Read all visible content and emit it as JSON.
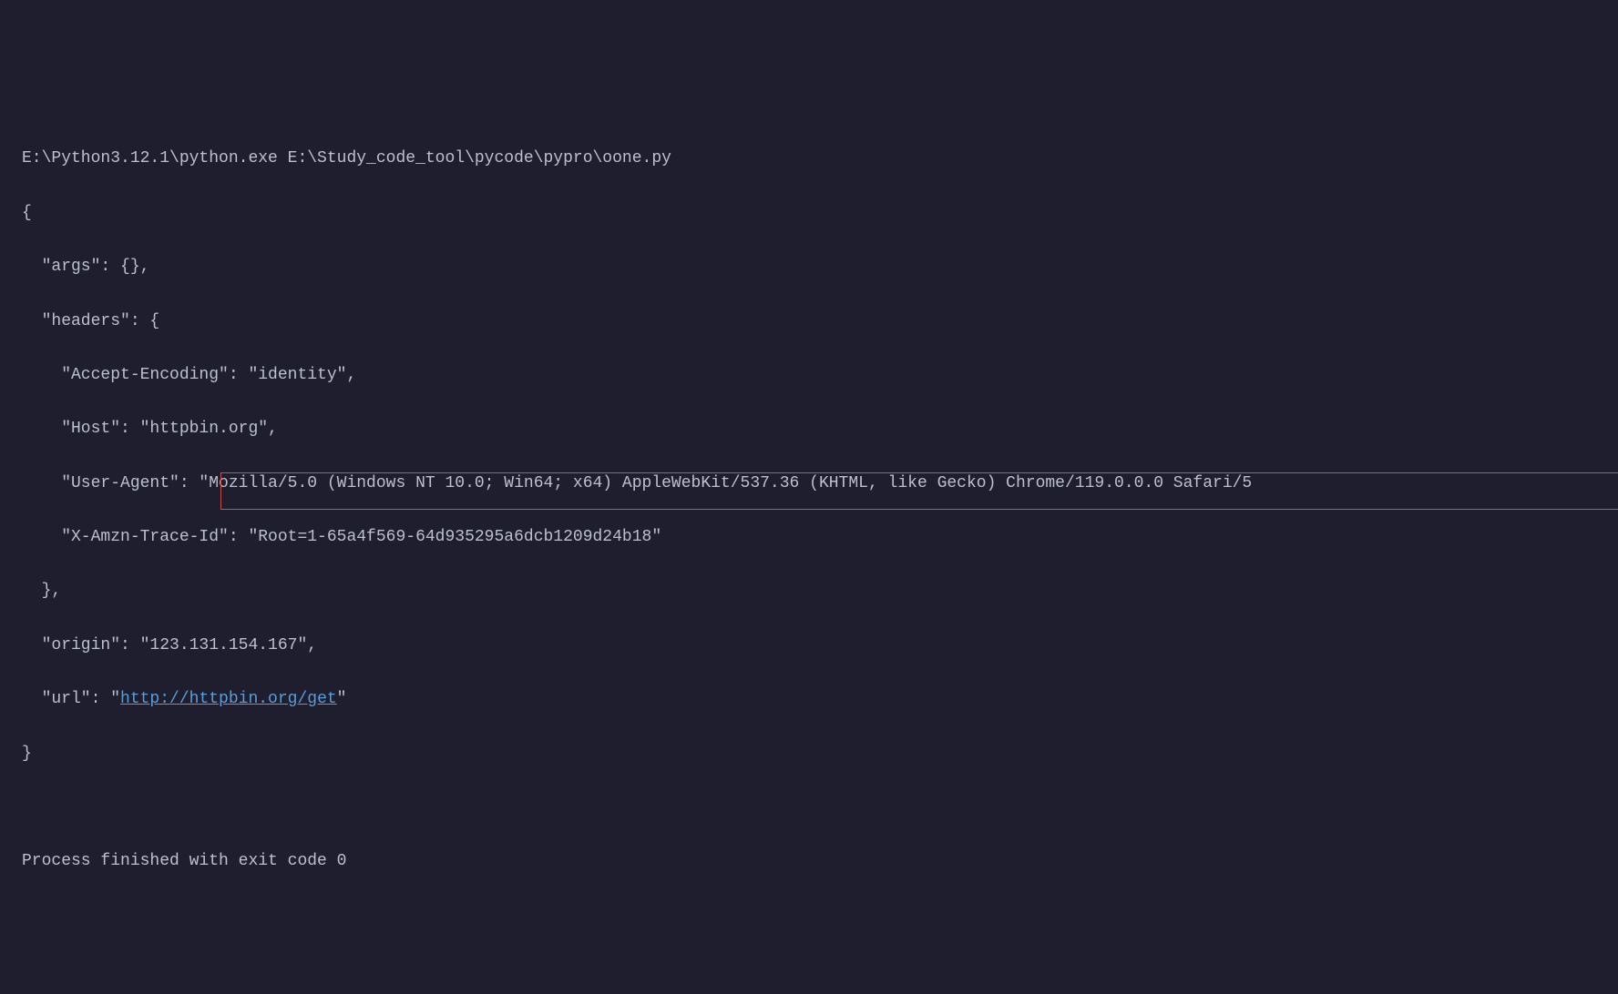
{
  "command_line": "E:\\Python3.12.1\\python.exe E:\\Study_code_tool\\pycode\\pypro\\oone.py",
  "json_open": "{",
  "args_line": "  \"args\": {}, ",
  "headers_open": "  \"headers\": {",
  "accept_encoding": "    \"Accept-Encoding\": \"identity\", ",
  "host_line": "    \"Host\": \"httpbin.org\", ",
  "user_agent_line": "    \"User-Agent\": \"Mozilla/5.0 (Windows NT 10.0; Win64; x64) AppleWebKit/537.36 (KHTML, like Gecko) Chrome/119.0.0.0 Safari/5",
  "trace_id_line": "    \"X-Amzn-Trace-Id\": \"Root=1-65a4f569-64d935295a6dcb1209d24b18\"",
  "headers_close": "  }, ",
  "origin_line": "  \"origin\": \"123.131.154.167\", ",
  "url_prefix": "  \"url\": \"",
  "url_link": "http://httpbin.org/get",
  "url_suffix": "\"",
  "json_close": "}",
  "blank": "",
  "exit_message": "Process finished with exit code 0"
}
